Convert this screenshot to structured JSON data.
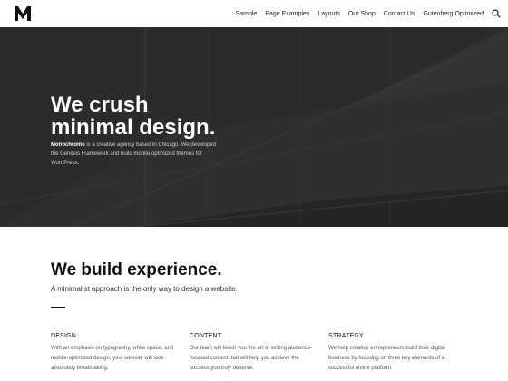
{
  "header": {
    "logo_letter": "M",
    "nav": [
      "Sample",
      "Page Examples",
      "Layouts",
      "Our Shop",
      "Contact Us",
      "Gutenberg Optimized"
    ]
  },
  "hero": {
    "title": "We crush\nminimal design.",
    "brand": "Monochrome",
    "description_rest": " is a creative agency based in Chicago. We developed the Genesis Framework and build mobile-optimized themes for WordPress."
  },
  "section": {
    "title": "We build experience.",
    "subtitle": "A minimalist approach is the only way to design a website."
  },
  "columns": [
    {
      "title": "DESIGN",
      "text": "With an emphasis on typography, white space, and mobile-optimized design, your website will look absolutely breathtaking."
    },
    {
      "title": "CONTENT",
      "text": "Our team will teach you the art of writing audience-focused content that will help you achieve the success you truly deserve."
    },
    {
      "title": "STRATEGY",
      "text": "We help creative entrepreneurs build their digital business by focusing on three key elements of a successful online platform."
    }
  ]
}
